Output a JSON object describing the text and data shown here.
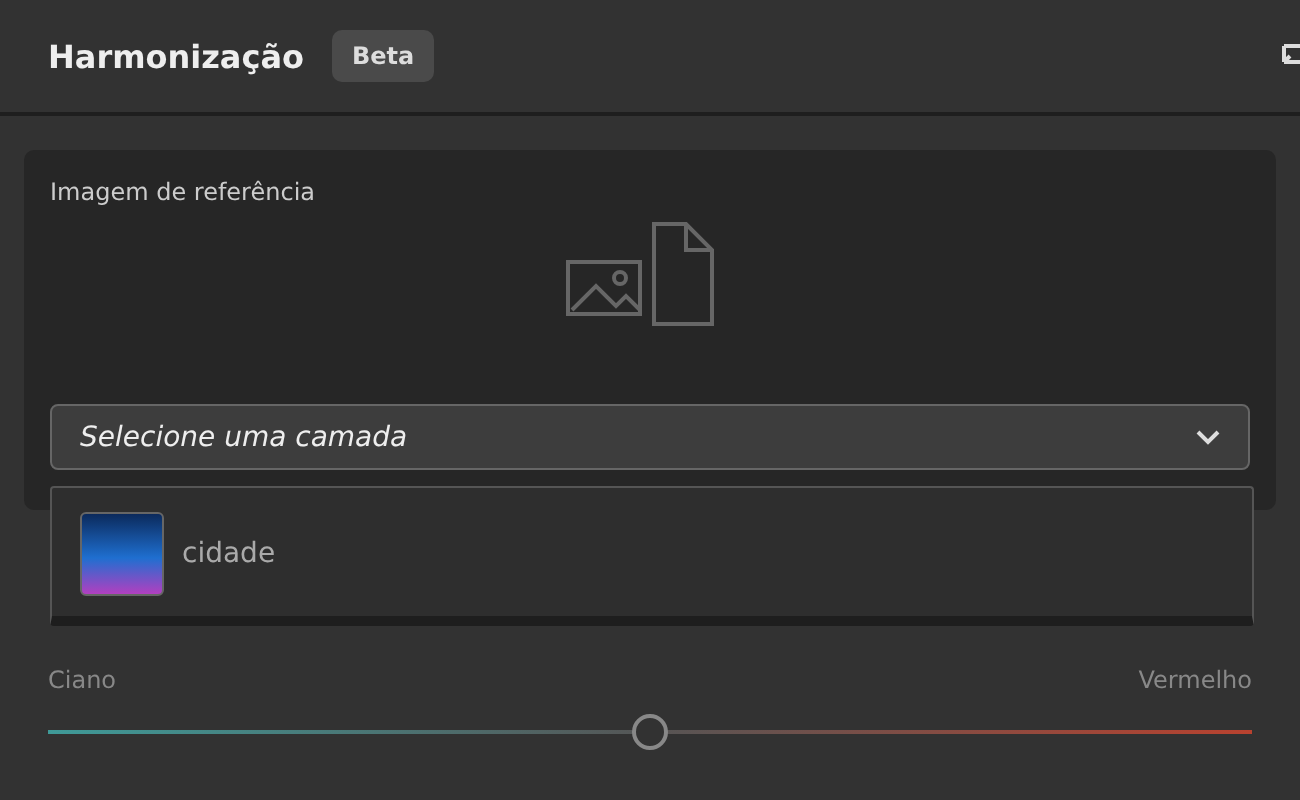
{
  "panel": {
    "title": "Harmonização",
    "badge": "Beta"
  },
  "reference": {
    "label": "Imagem de referência",
    "dropdown": {
      "placeholder": "Selecione uma camada",
      "expanded": true
    },
    "options": [
      {
        "label": "cidade",
        "selected": false
      }
    ]
  },
  "sliders": [
    {
      "left": "Ciano",
      "right": "Vermelho",
      "level": 0.5
    }
  ]
}
